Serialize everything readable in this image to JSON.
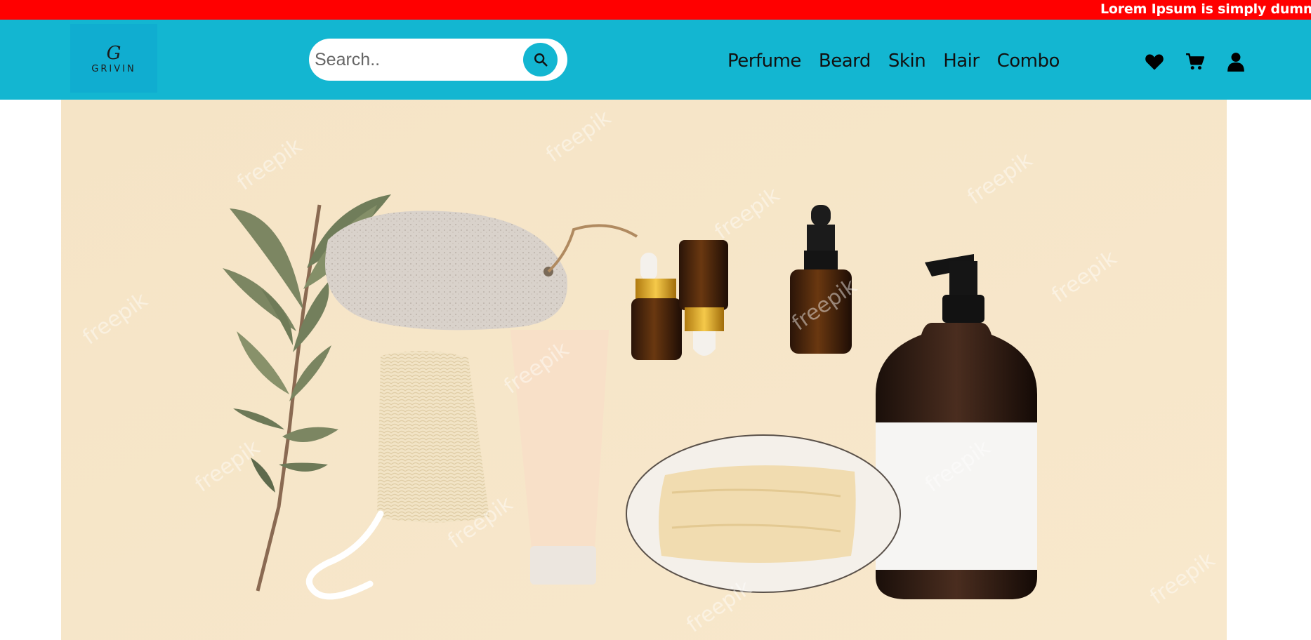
{
  "announcement": {
    "text": "Lorem Ipsum is simply dummy tex"
  },
  "brand": {
    "mark": "G",
    "name": "GRIVIN"
  },
  "search": {
    "placeholder": "Search..",
    "icon": "search-icon"
  },
  "nav": {
    "items": [
      "Perfume",
      "Beard",
      "Skin",
      "Hair",
      "Combo"
    ]
  },
  "header_icons": [
    "heart-icon",
    "cart-icon",
    "user-icon"
  ],
  "hero": {
    "watermark": "freepik"
  },
  "colors": {
    "announcement_bg": "#ff0000",
    "header_bg": "#13b6d1",
    "hero_bg": "#f7e6c7"
  }
}
